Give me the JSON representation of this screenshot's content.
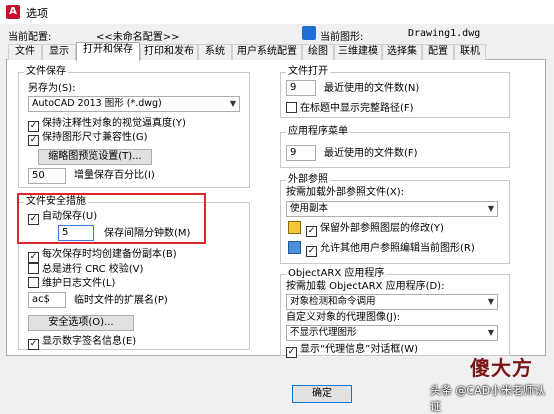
{
  "window": {
    "title": "选项",
    "icon_glyph": "A"
  },
  "profile": {
    "current_profile_label": "当前配置:",
    "current_profile_value": "<<未命名配置>>",
    "current_drawing_label": "当前图形:",
    "current_drawing_value": "Drawing1.dwg"
  },
  "tabs": [
    "文件",
    "显示",
    "打开和保存",
    "打印和发布",
    "系统",
    "用户系统配置",
    "绘图",
    "三维建模",
    "选择集",
    "配置",
    "联机"
  ],
  "active_tab": "打开和保存",
  "file_save": {
    "legend": "文件保存",
    "save_as_label": "另存为(S):",
    "save_as_value": "AutoCAD 2013 图形 (*.dwg)",
    "keep_annotative_label": "保持注释性对象的视觉逼真度(Y)",
    "keep_annotative_checked": true,
    "keep_size_compat_label": "保持图形尺寸兼容性(G)",
    "keep_size_compat_checked": true,
    "thumbnail_button": "缩略图预览设置(T)...",
    "incremental_value": "50",
    "incremental_label": "增量保存百分比(I)"
  },
  "file_safety": {
    "legend": "文件安全措施",
    "autosave_label": "自动保存(U)",
    "autosave_checked": true,
    "minutes_value": "5",
    "minutes_label": "保存间隔分钟数(M)",
    "backup_label": "每次保存时均创建备份副本(B)",
    "backup_checked": true,
    "crc_label": "总是进行 CRC 校验(V)",
    "crc_checked": false,
    "log_label": "维护日志文件(L)",
    "log_checked": false,
    "temp_ext_value": "ac$",
    "temp_ext_label": "临时文件的扩展名(P)",
    "security_button": "安全选项(O)...",
    "digital_sig_label": "显示数字签名信息(E)",
    "digital_sig_checked": true
  },
  "file_open": {
    "legend": "文件打开",
    "recent_value": "9",
    "recent_label": "最近使用的文件数(N)",
    "full_path_label": "在标题中显示完整路径(F)",
    "full_path_checked": false
  },
  "app_menu": {
    "legend": "应用程序菜单",
    "recent_value": "9",
    "recent_label": "最近使用的文件数(F)"
  },
  "xref": {
    "legend": "外部参照",
    "demand_load_label": "按需加载外部参照文件(X):",
    "demand_load_value": "使用副本",
    "retain_changes_label": "保留外部参照图层的修改(Y)",
    "retain_changes_checked": true,
    "allow_edit_label": "允许其他用户参照编辑当前图形(R)",
    "allow_edit_checked": true
  },
  "objectarx": {
    "legend": "ObjectARX 应用程序",
    "load_label": "按需加载 ObjectARX 应用程序(D):",
    "load_value": "对象检测和命令调用",
    "proxy_label": "自定义对象的代理图像(J):",
    "proxy_value": "不显示代理图形",
    "proxy_info_label": "显示“代理信息”对话框(W)",
    "proxy_info_checked": true
  },
  "ok_button": "确定",
  "watermark": {
    "big": "傻大方",
    "sub": "头条 @CAD小米老师认证"
  },
  "colors": {
    "highlight": "#e0262c"
  }
}
